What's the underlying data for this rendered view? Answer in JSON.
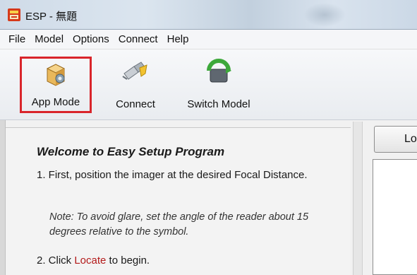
{
  "window": {
    "title": "ESP - 無題",
    "icon": "esp-app-icon"
  },
  "menu": {
    "items": [
      "File",
      "Model",
      "Options",
      "Connect",
      "Help"
    ]
  },
  "toolbar": {
    "buttons": [
      {
        "label": "App Mode",
        "icon": "app-mode-box-icon",
        "highlighted": true
      },
      {
        "label": "Connect",
        "icon": "connect-plug-icon"
      },
      {
        "label": "Switch Model",
        "icon": "switch-model-icon"
      }
    ],
    "highlight_color": "#d9252b"
  },
  "content": {
    "welcome_title": "Welcome to Easy Setup Program",
    "step1": "1. First, position the imager at the desired Focal Distance.",
    "note": "Note: To avoid glare, set the angle of the reader about 15 degrees relative to the symbol.",
    "step2_prefix": "2. Click ",
    "step2_link": "Locate",
    "step2_suffix": " to begin.",
    "locate_color": "#b31a1a"
  },
  "right_panel": {
    "button_label": "Lo"
  }
}
